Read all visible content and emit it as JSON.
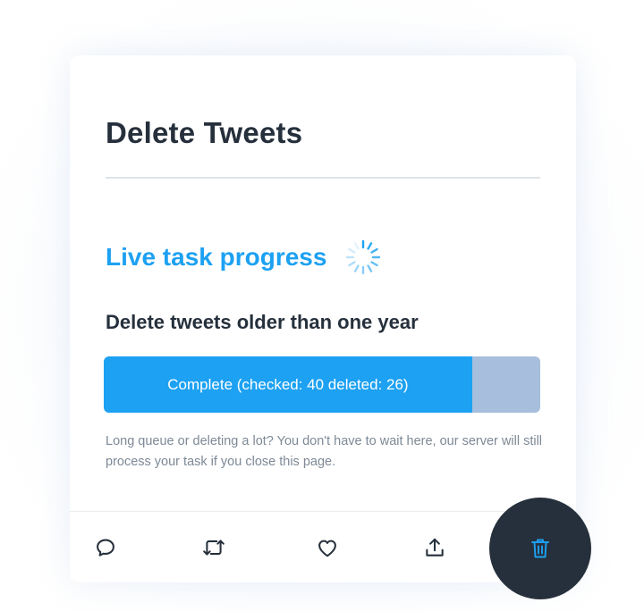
{
  "card": {
    "title": "Delete Tweets",
    "live_heading": "Live task progress",
    "task_title": "Delete tweets older than one year",
    "progress": {
      "label": "Complete (checked: 40 deleted: 26)",
      "fraction": 0.844
    },
    "note": "Long queue or deleting a lot? You don't have to wait here, our server will still process your task if you close this page."
  },
  "actions": [
    {
      "icon": "reply-icon"
    },
    {
      "icon": "retweet-icon"
    },
    {
      "icon": "like-icon"
    },
    {
      "icon": "share-icon"
    }
  ],
  "delete_button": {
    "icon": "trash-icon"
  },
  "colors": {
    "accent": "#1da1f2",
    "progress_track": "#a7bfdc",
    "heading": "#26303c",
    "note_text": "#7d8996",
    "delete_button_bg": "#26303c"
  }
}
